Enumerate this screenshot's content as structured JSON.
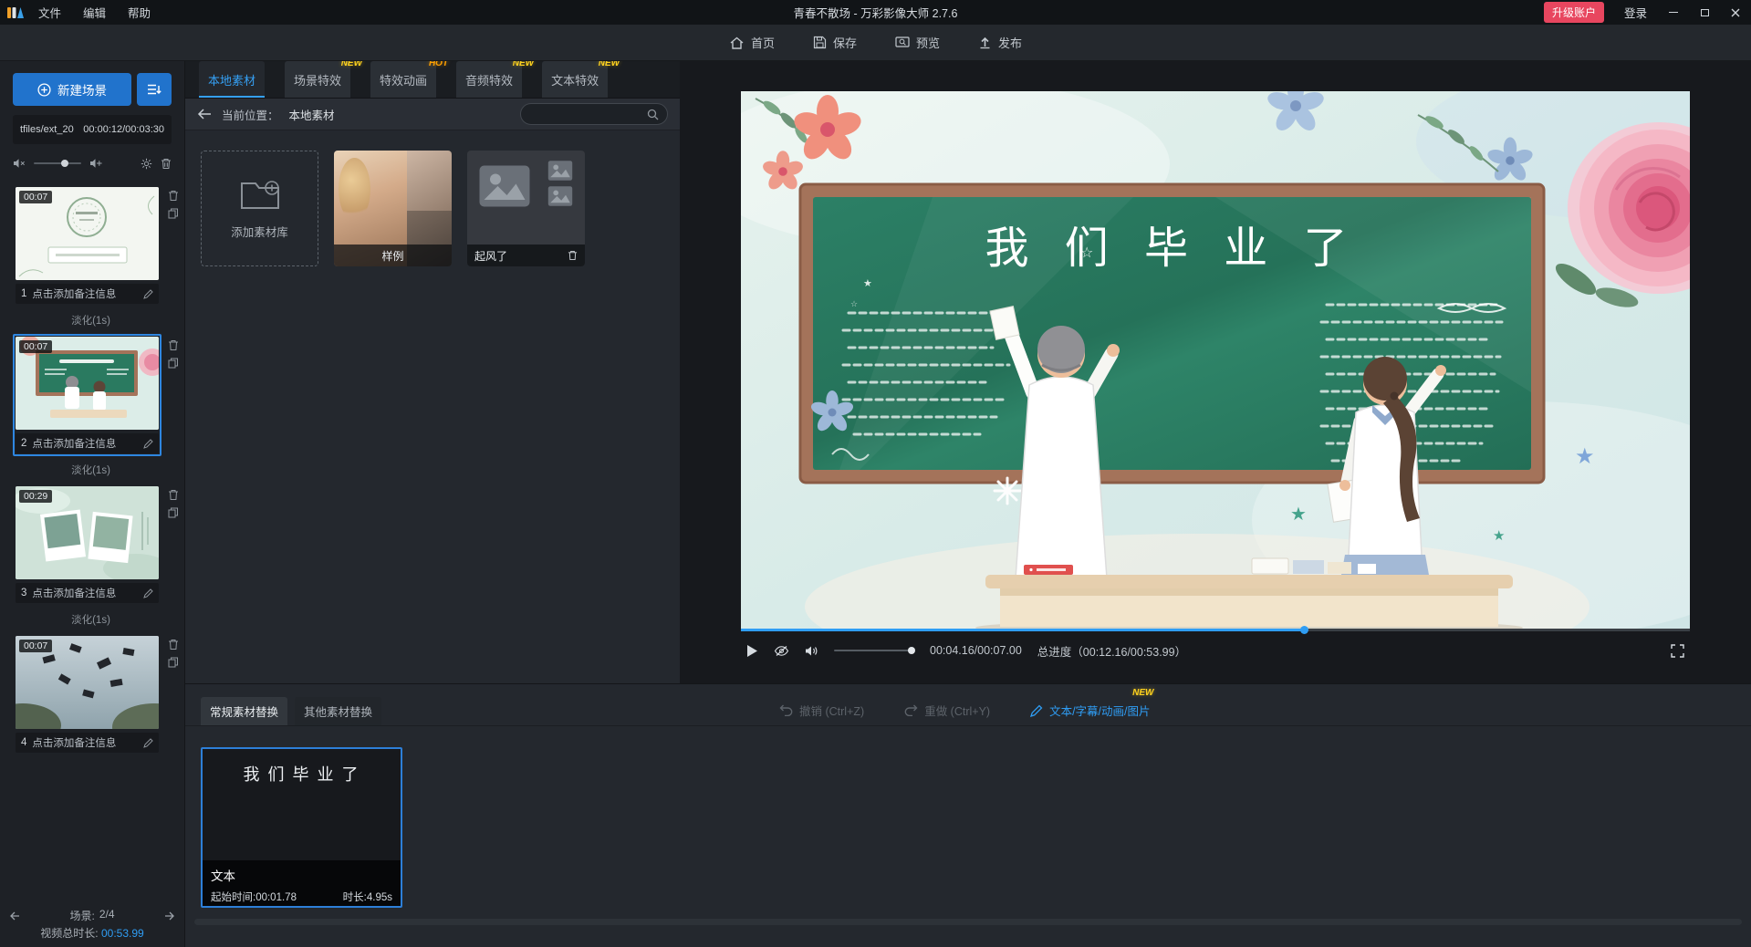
{
  "titlebar": {
    "menu": [
      {
        "label": "文件"
      },
      {
        "label": "编辑"
      },
      {
        "label": "帮助"
      }
    ],
    "title": "青春不散场 - 万彩影像大师 2.7.6",
    "upgrade_label": "升级账户",
    "login_label": "登录"
  },
  "toolbar": {
    "home": "首页",
    "save": "保存",
    "preview": "预览",
    "publish": "发布"
  },
  "sidebar": {
    "new_scene_label": "新建场景",
    "track_name": "tfiles/ext_20",
    "track_time": "00:00:12/00:03:30",
    "scenes": [
      {
        "num": "1",
        "duration": "00:07",
        "note": "点击添加备注信息"
      },
      {
        "num": "2",
        "duration": "00:07",
        "note": "点击添加备注信息"
      },
      {
        "num": "3",
        "duration": "00:29",
        "note": "点击添加备注信息"
      },
      {
        "num": "4",
        "duration": "00:07",
        "note": "点击添加备注信息"
      }
    ],
    "transition_label": "淡化(1s)",
    "footer": {
      "scene_label": "场景:",
      "scene_value": "2/4",
      "duration_label": "视频总时长:",
      "duration_value": "00:53.99"
    }
  },
  "materials": {
    "tabs": [
      {
        "label": "本地素材",
        "badge": ""
      },
      {
        "label": "场景特效",
        "badge": "NEW"
      },
      {
        "label": "特效动画",
        "badge": "HOT"
      },
      {
        "label": "音频特效",
        "badge": "NEW"
      },
      {
        "label": "文本特效",
        "badge": "NEW"
      }
    ],
    "location_label": "当前位置：",
    "location_value": "本地素材",
    "add_item_label": "添加素材库",
    "folder1_label": "样例",
    "folder2_label": "起风了"
  },
  "player": {
    "stage_title": "我 们 毕 业 了",
    "time": "00:04.16/00:07.00",
    "total_label": "总进度（00:12.16/00:53.99）"
  },
  "replace_panel": {
    "tab1": "常规素材替换",
    "tab2": "其他素材替换",
    "undo_label": "撤销 (Ctrl+Z)",
    "redo_label": "重做 (Ctrl+Y)",
    "edit_label": "文本/字幕/动画/图片",
    "edit_badge": "NEW",
    "card": {
      "text": "我 们 毕 业 了",
      "type_label": "文本",
      "start_label": "起始时间:00:01.78",
      "duration_label": "时长:4.95s"
    }
  },
  "icons": {
    "home": "house",
    "save": "floppy",
    "preview": "monitor-magnifier",
    "publish": "arrow-up",
    "search": "magnifier",
    "settings": "gear",
    "delete": "trash",
    "duplicate": "copy",
    "edit": "pencil",
    "play": "triangle",
    "volume": "speaker",
    "fullscreen": "corner-brackets"
  }
}
